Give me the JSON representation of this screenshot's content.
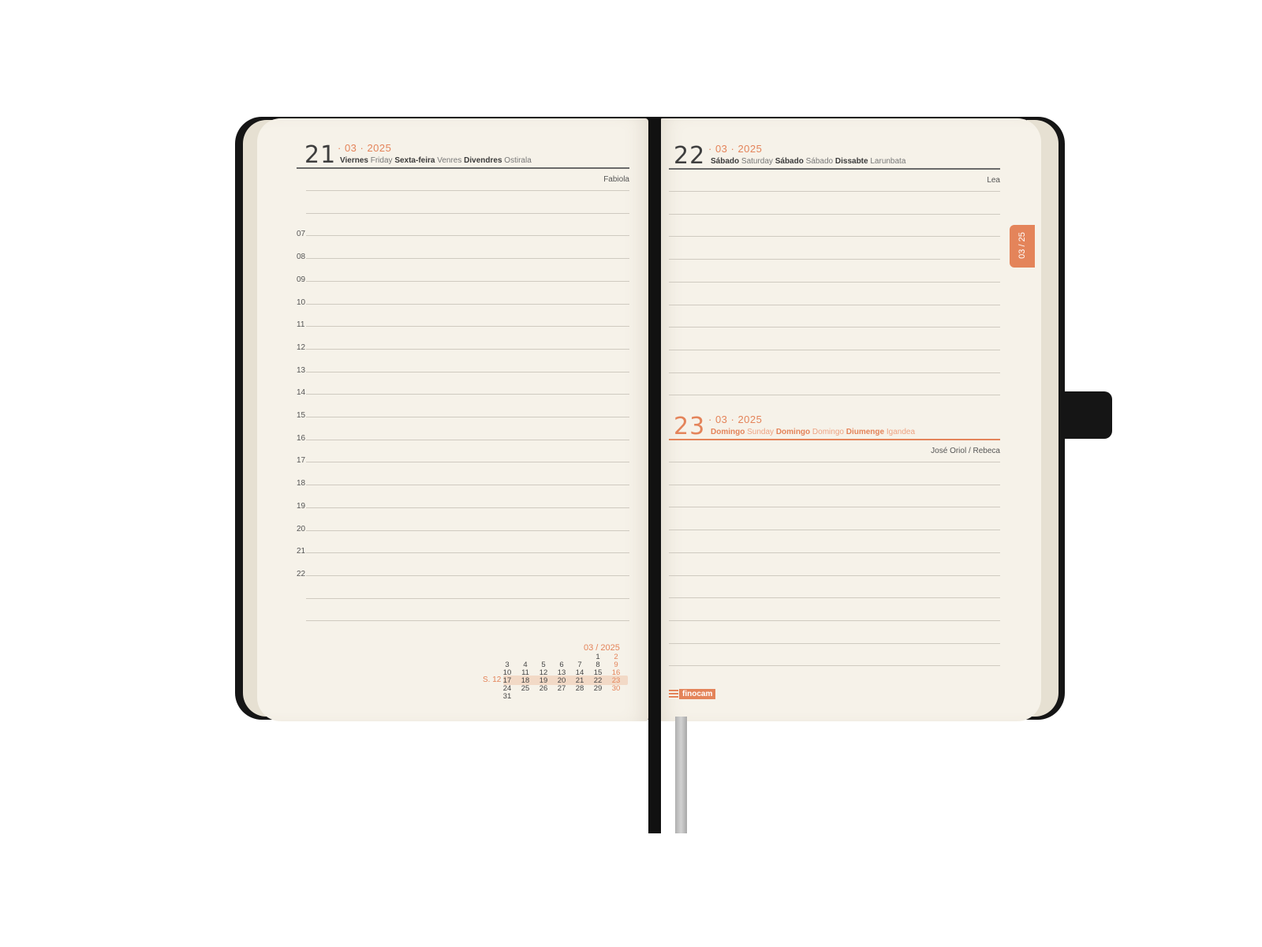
{
  "left_page": {
    "day_number": "21",
    "date_line": "· 03 · 2025",
    "weekdays": [
      {
        "text": "Viernes",
        "bold": true
      },
      {
        "text": "Friday",
        "bold": false
      },
      {
        "text": "Sexta-feira",
        "bold": true
      },
      {
        "text": "Venres",
        "bold": false
      },
      {
        "text": "Divendres",
        "bold": true
      },
      {
        "text": "Ostirala",
        "bold": false
      }
    ],
    "saint": "Fabiola",
    "hours": [
      "07",
      "08",
      "09",
      "10",
      "11",
      "12",
      "13",
      "14",
      "15",
      "16",
      "17",
      "18",
      "19",
      "20",
      "21",
      "22"
    ],
    "mini_calendar": {
      "header": "03 / 2025",
      "week_label": "S. 12",
      "rows": [
        [
          "",
          "",
          "",
          "",
          "",
          "1",
          "2"
        ],
        [
          "3",
          "4",
          "5",
          "6",
          "7",
          "8",
          "9"
        ],
        [
          "10",
          "11",
          "12",
          "13",
          "14",
          "15",
          "16"
        ],
        [
          "17",
          "18",
          "19",
          "20",
          "21",
          "22",
          "23"
        ],
        [
          "24",
          "25",
          "26",
          "27",
          "28",
          "29",
          "30"
        ],
        [
          "31",
          "",
          "",
          "",
          "",
          "",
          ""
        ]
      ]
    }
  },
  "right_page": {
    "top_day": {
      "day_number": "22",
      "date_line": "· 03 · 2025",
      "weekdays": [
        {
          "text": "Sábado",
          "bold": true
        },
        {
          "text": "Saturday",
          "bold": false
        },
        {
          "text": "Sábado",
          "bold": true
        },
        {
          "text": "Sábado",
          "bold": false
        },
        {
          "text": "Dissabte",
          "bold": true
        },
        {
          "text": "Larunbata",
          "bold": false
        }
      ],
      "saint": "Lea"
    },
    "bottom_day": {
      "day_number": "23",
      "date_line": "· 03 · 2025",
      "weekdays": [
        {
          "text": "Domingo",
          "bold": true
        },
        {
          "text": "Sunday",
          "bold": false
        },
        {
          "text": "Domingo",
          "bold": true
        },
        {
          "text": "Domingo",
          "bold": false
        },
        {
          "text": "Diumenge",
          "bold": true
        },
        {
          "text": "Igandea",
          "bold": false
        }
      ],
      "saint": "José Oriol / Rebeca"
    },
    "month_tab": "03 / 25",
    "brand": "finocam"
  },
  "colors": {
    "accent": "#e4845a",
    "cover": "#151515",
    "paper": "#f6f2e9",
    "ribbon": "#bcbcbc"
  }
}
